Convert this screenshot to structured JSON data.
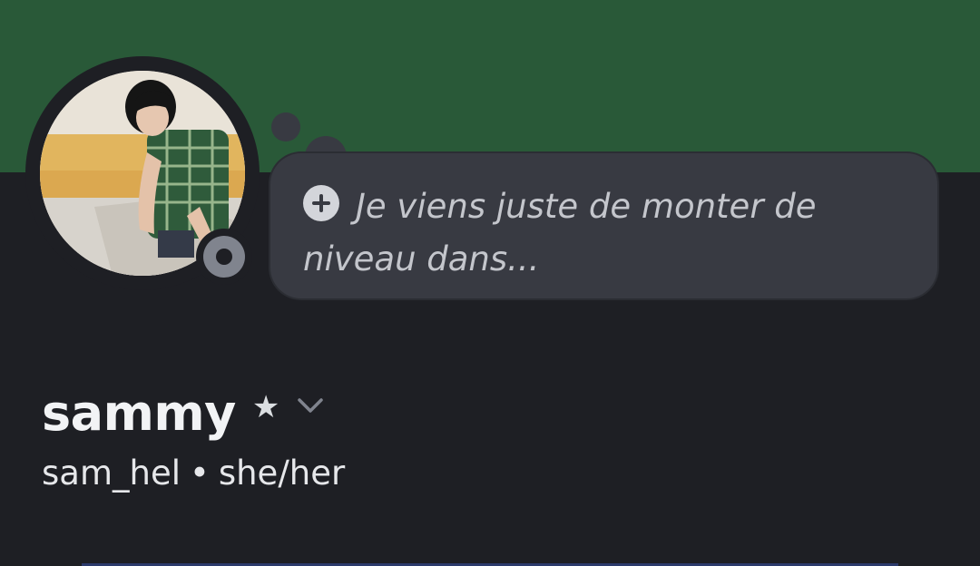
{
  "profile": {
    "banner_color": "#295938",
    "status": "offline",
    "status_message": "Je viens juste de monter de niveau dans...",
    "display_name": "sammy",
    "username": "sam_hel",
    "separator": "•",
    "pronouns": "she/her"
  },
  "icons": {
    "add_status": "plus-circle-icon",
    "favorite": "star-icon",
    "expand": "chevron-down-icon",
    "status_indicator": "offline-status-icon"
  }
}
